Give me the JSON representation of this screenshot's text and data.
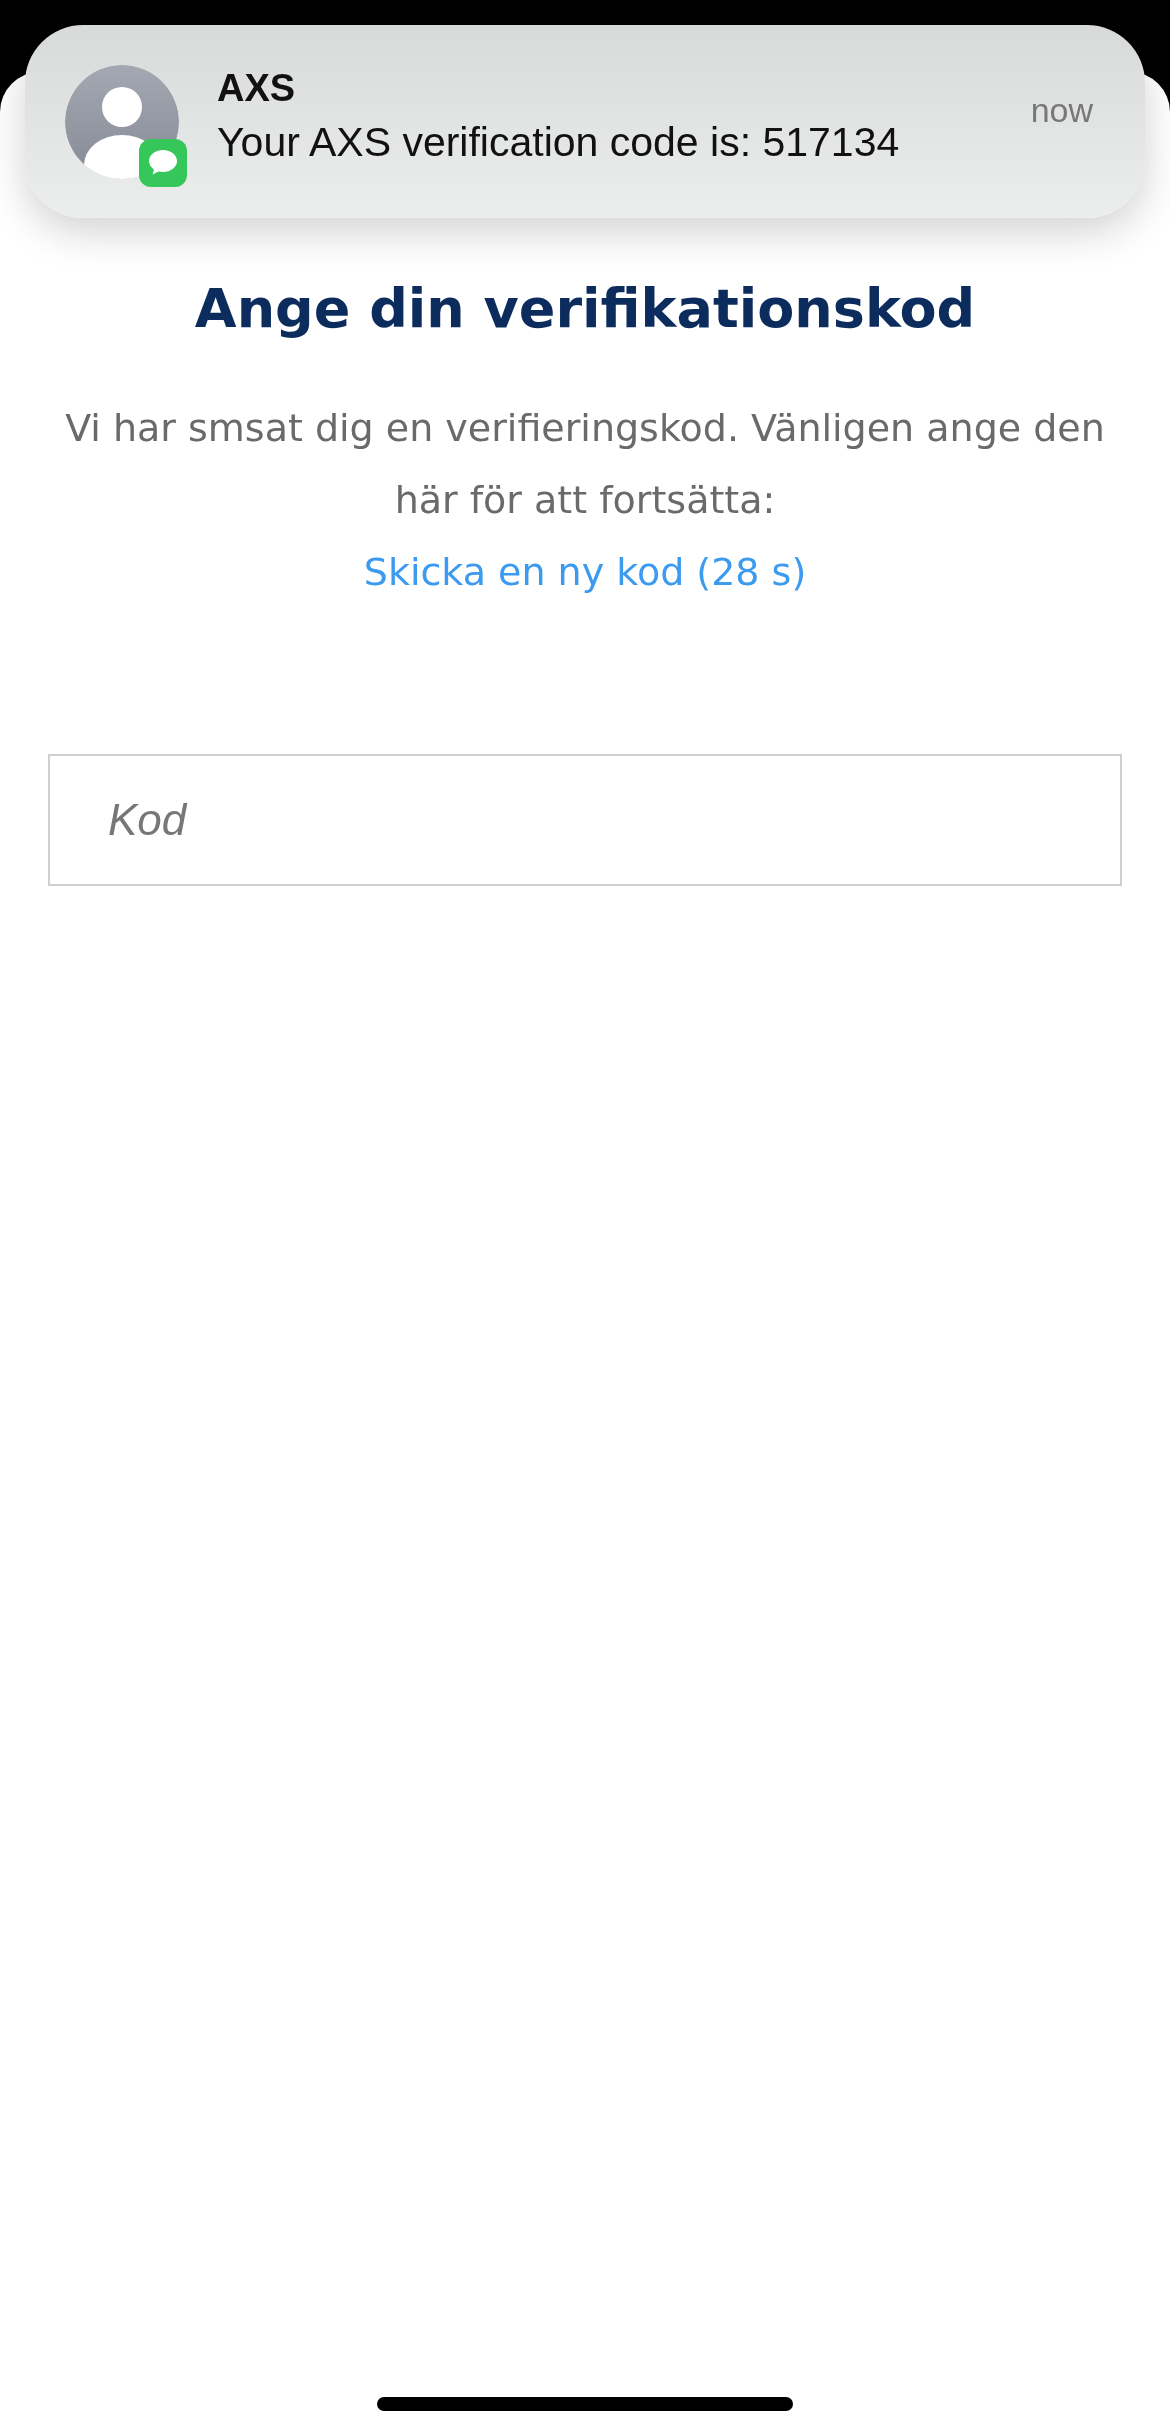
{
  "notification": {
    "sender": "AXS",
    "message": "Your AXS verification code is: 517134",
    "time": "now"
  },
  "page": {
    "title": "Ange din verifikationskod",
    "description": "Vi har smsat dig en verifieringskod. Vänligen ange den här för att fortsätta:",
    "resend_link": "Skicka en ny kod (28 s)",
    "code_field": {
      "placeholder": "Kod"
    }
  }
}
